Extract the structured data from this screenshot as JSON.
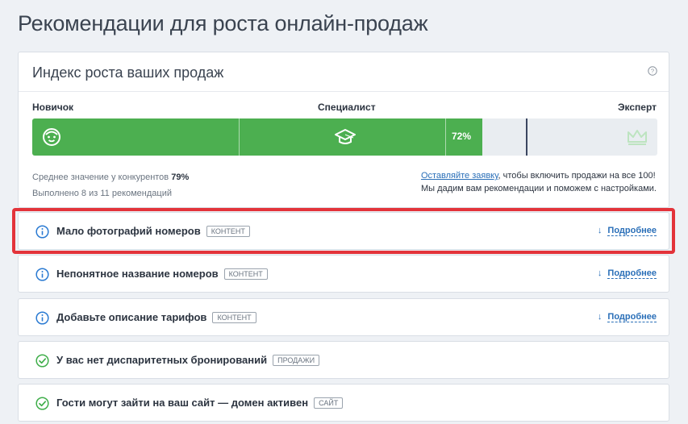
{
  "page": {
    "title": "Рекомендации для роста онлайн-продаж"
  },
  "index": {
    "title": "Индекс роста ваших продаж",
    "levels": [
      "Новичок",
      "Специалист",
      "Эксперт"
    ],
    "progress_percent": 72,
    "progress_label": "72%",
    "competitor_avg_percent": 79,
    "stats_prefix": "Среднее значение у конкурентов",
    "stats_value": "79%",
    "completed_text": "Выполнено 8 из 11 рекомендаций",
    "cta_link": "Оставляйте заявку",
    "cta_rest": ", чтобы включить продажи на все 100!",
    "cta_line2": "Мы дадим вам рекомендации и поможем с настройками."
  },
  "recommendations": [
    {
      "title": "Мало фотографий номеров",
      "tag": "КОНТЕНТ",
      "status": "info",
      "more": "Подробнее"
    },
    {
      "title": "Непонятное название номеров",
      "tag": "КОНТЕНТ",
      "status": "info",
      "more": "Подробнее"
    },
    {
      "title": "Добавьте описание тарифов",
      "tag": "КОНТЕНТ",
      "status": "info",
      "more": "Подробнее"
    },
    {
      "title": "У вас нет диспаритетных бронирований",
      "tag": "ПРОДАЖИ",
      "status": "done"
    },
    {
      "title": "Гости могут зайти на ваш сайт — домен активен",
      "tag": "САЙТ",
      "status": "done"
    }
  ],
  "colors": {
    "progress": "#4caf50",
    "link": "#2a6fb8",
    "info_icon": "#2a7ad2",
    "done_icon": "#3fae4a",
    "highlight": "#e3333a"
  }
}
